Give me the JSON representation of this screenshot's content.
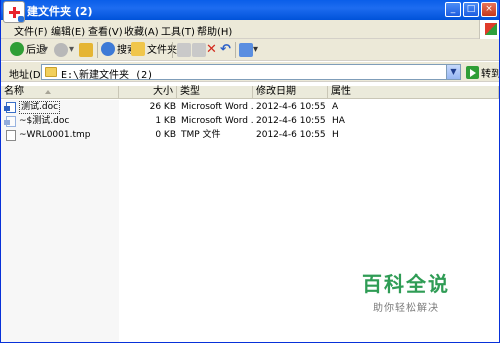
{
  "window": {
    "title": "建文件夹 (2)",
    "controls": {
      "minimize": "_",
      "maximize": "□",
      "close": "×"
    }
  },
  "menu": [
    "文件(F)",
    "编辑(E)",
    "查看(V)",
    "收藏(A)",
    "工具(T)",
    "帮助(H)"
  ],
  "toolbar": {
    "back_label": "后退",
    "search_label": "搜索",
    "folders_label": "文件夹"
  },
  "address": {
    "label": "地址(D)",
    "value": "E:\\新建文件夹 (2)",
    "go_label": "转到"
  },
  "columns": {
    "name": "名称",
    "size": "大小",
    "type": "类型",
    "modified": "修改日期",
    "attributes": "属性"
  },
  "files": [
    {
      "name": "测试.doc",
      "size": "26 KB",
      "type": "Microsoft Word ...",
      "modified": "2012-4-6 10:55",
      "attr": "A",
      "icon": "word-icon"
    },
    {
      "name": "~$测试.doc",
      "size": "1 KB",
      "type": "Microsoft Word ...",
      "modified": "2012-4-6 10:55",
      "attr": "HA",
      "icon": "word-icon"
    },
    {
      "name": "~WRL0001.tmp",
      "size": "0 KB",
      "type": "TMP 文件",
      "modified": "2012-4-6 10:55",
      "attr": "H",
      "icon": "tmp-file-icon"
    }
  ],
  "watermark": {
    "title": "百科全说",
    "subtitle": "助你轻松解决"
  },
  "colors": {
    "titlebar": "#0a5ee9",
    "chrome": "#ece9d8",
    "go": "#2f9e36",
    "watermark": "#2f9c55"
  }
}
